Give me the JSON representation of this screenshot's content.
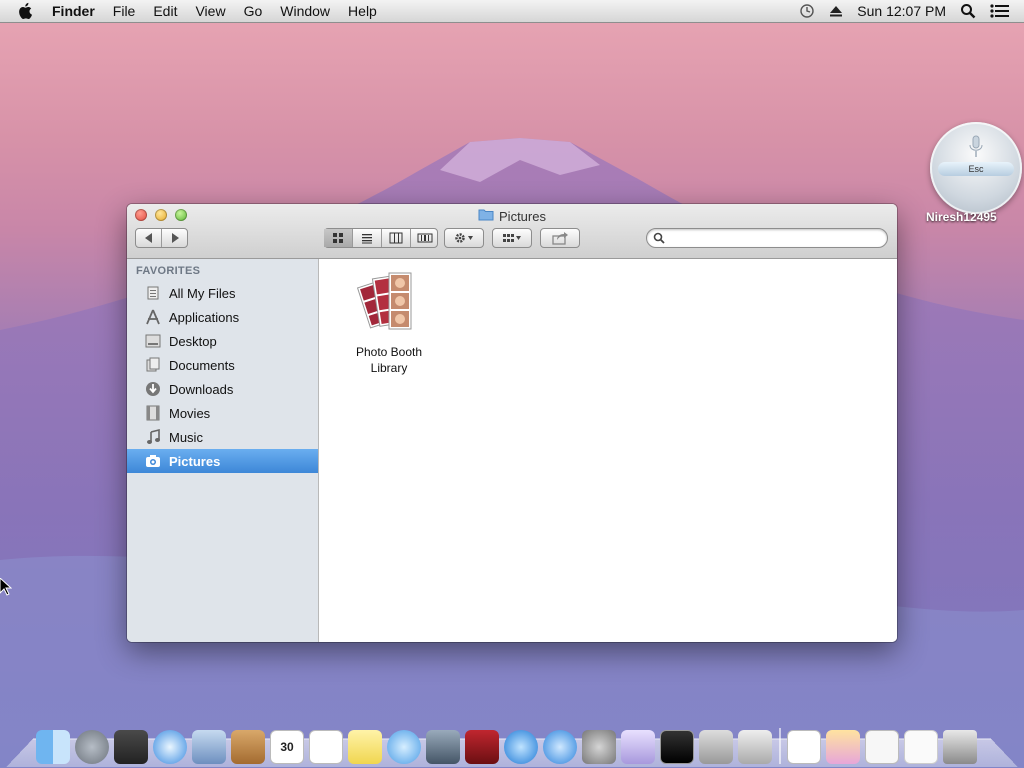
{
  "menubar": {
    "app": "Finder",
    "items": [
      "File",
      "Edit",
      "View",
      "Go",
      "Window",
      "Help"
    ],
    "clock": "Sun 12:07 PM"
  },
  "window": {
    "title": "Pictures",
    "search": {
      "value": "",
      "placeholder": ""
    },
    "sidebar": {
      "header": "FAVORITES",
      "items": [
        {
          "label": "All My Files",
          "icon": "all-files-icon"
        },
        {
          "label": "Applications",
          "icon": "applications-icon"
        },
        {
          "label": "Desktop",
          "icon": "desktop-icon"
        },
        {
          "label": "Documents",
          "icon": "documents-icon"
        },
        {
          "label": "Downloads",
          "icon": "downloads-icon"
        },
        {
          "label": "Movies",
          "icon": "movies-icon"
        },
        {
          "label": "Music",
          "icon": "music-icon"
        },
        {
          "label": "Pictures",
          "icon": "pictures-icon",
          "selected": true
        }
      ]
    },
    "files": [
      {
        "name": "Photo Booth Library",
        "icon": "photo-booth-icon"
      }
    ]
  },
  "widget": {
    "esc_label": "Esc",
    "user": "Niresh12495"
  },
  "dock": {
    "calendar_day": "30"
  },
  "colors": {
    "selection": "#3d87d8",
    "sidebar": "#dfe4ea"
  }
}
